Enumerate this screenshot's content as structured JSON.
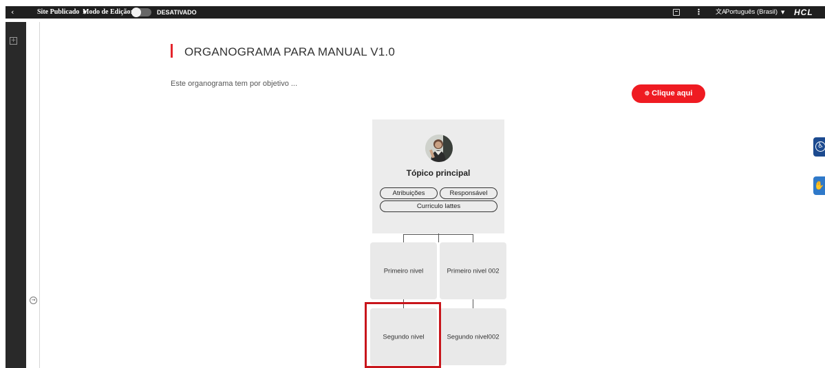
{
  "topbar": {
    "back_icon": "‹",
    "site_status": "Site Publicado",
    "edit_mode_label": "Modo de Edição:",
    "edit_mode_state": "DESATIVADO",
    "more_icon": "⋮",
    "translate_icon": "文A",
    "language": "Português (Brasil)",
    "brand": "HCL"
  },
  "page": {
    "title": "ORGANOGRAMA PARA MANUAL V1.0",
    "description": "Este organograma tem por objetivo ...",
    "cta_label": "Clique aqui",
    "cta_icon": "sitemap-icon"
  },
  "org": {
    "main": {
      "title": "Tópico principal",
      "buttons": [
        "Atribuições",
        "Responsável",
        "Curriculo lattes"
      ]
    },
    "level1": [
      "Primeiro nivel",
      "Primeiro nivel 002"
    ],
    "level2": [
      "Segundo nivel",
      "Segundo nivel002"
    ]
  },
  "colors": {
    "accent": "#e4252c",
    "cta": "#ef1b22",
    "topbar": "#1f1f1f",
    "rail": "#292929",
    "node": "#e9e9e9",
    "highlight": "#c8151b",
    "accessibility": "#1c4a8f",
    "libras": "#2f79c9"
  }
}
